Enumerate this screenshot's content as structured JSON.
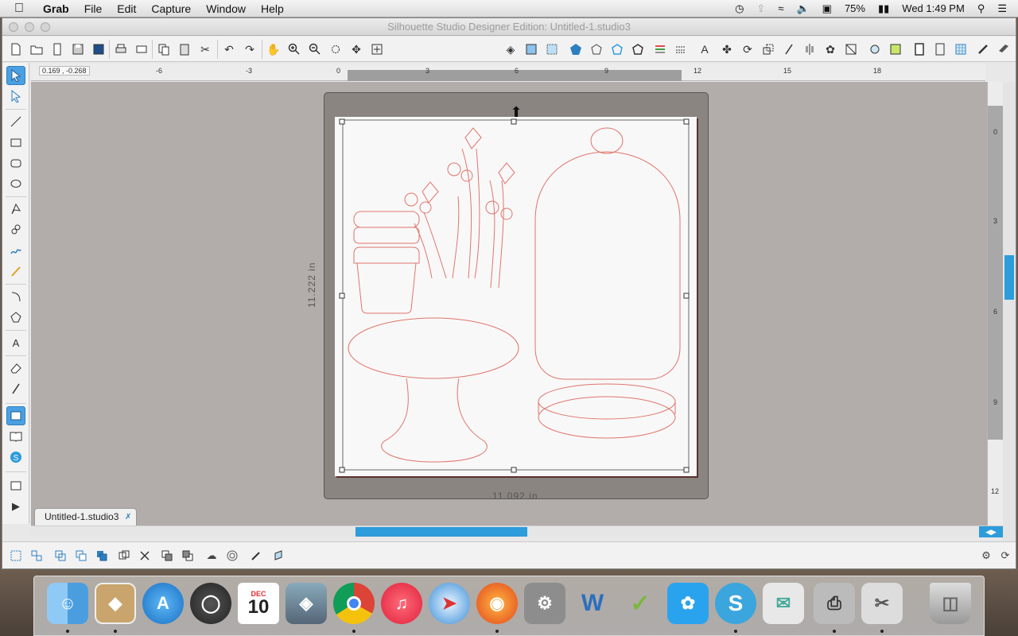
{
  "menubar": {
    "app": "Grab",
    "menus": [
      "File",
      "Edit",
      "Capture",
      "Window",
      "Help"
    ],
    "battery": "75%",
    "clock": "Wed 1:49 PM"
  },
  "window": {
    "title": "Silhouette Studio Designer Edition: Untitled-1.studio3"
  },
  "ruler": {
    "coords": "0.169 , -0.268",
    "h_labels": [
      "-6",
      "-3",
      "0",
      "3",
      "6",
      "9",
      "12",
      "15",
      "18"
    ],
    "v_labels": [
      "0",
      "3",
      "6",
      "9",
      "12"
    ]
  },
  "canvas": {
    "width_label": "11.092 in",
    "height_label": "11.222 in",
    "line_color": "#e0756c"
  },
  "document_tab": {
    "label": "Untitled-1.studio3"
  },
  "dock": {
    "calendar_month": "DEC",
    "calendar_day": "10",
    "apps": [
      "finder",
      "preview",
      "app-store",
      "dashboard",
      "calendar",
      "iphoto",
      "chrome",
      "itunes",
      "safari",
      "firefox",
      "system-preferences",
      "word",
      "lync",
      "twitter",
      "silhouette-studio",
      "mail-stationery",
      "printer",
      "grab",
      "trash"
    ]
  }
}
